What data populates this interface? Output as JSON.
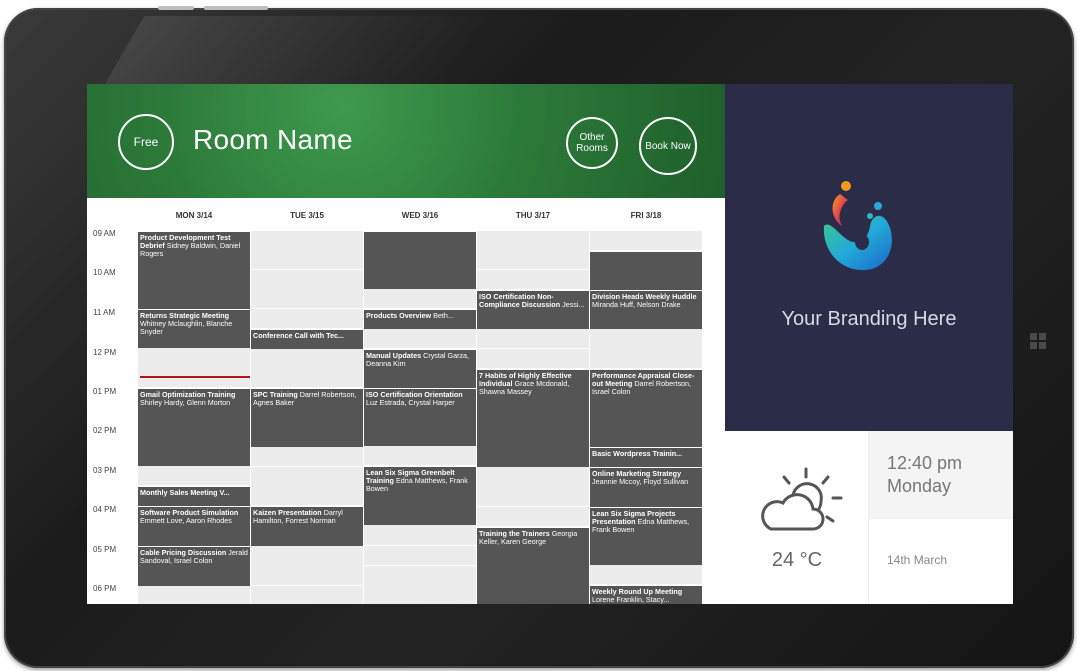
{
  "header": {
    "status": "Free",
    "room_name": "Room Name",
    "other_rooms": "Other Rooms",
    "book_now": "Book Now",
    "accent": "#2c7a3a"
  },
  "calendar": {
    "days": [
      "MON 3/14",
      "TUE 3/15",
      "WED 3/16",
      "THU 3/17",
      "FRI 3/18"
    ],
    "times": [
      "09 AM",
      "10 AM",
      "11 AM",
      "12 PM",
      "01 PM",
      "02 PM",
      "03 PM",
      "04 PM",
      "05 PM",
      "06 PM"
    ],
    "now_indicator_color": "#b3141c",
    "events": {
      "mon": [
        {
          "title": "Product Development Test Debrief",
          "people": " Sidney Baldwin, Daniel Rogers"
        },
        {
          "title": "Returns Strategic Meeting",
          "people": " Whitney Mclaughlin, Blanche Snyder"
        },
        {
          "title": "Gmail Optimization Training",
          "people": " Shirley Hardy, Glenn Morton"
        },
        {
          "title": "Monthly Sales Meeting V...",
          "people": ""
        },
        {
          "title": "Software Product Simulation",
          "people": " Emmett Love, Aaron Rhodes"
        },
        {
          "title": "Cable Pricing Discussion",
          "people": " Jerald Sandoval, Israel Colon"
        }
      ],
      "tue": [
        {
          "title": "Conference Call with Tec...",
          "people": ""
        },
        {
          "title": "SPC Training",
          "people": " Darrel Robertson, Agnes Baker"
        },
        {
          "title": "Kaizen Presentation",
          "people": " Darryl Hamilton, Forrest Norman"
        }
      ],
      "wed": [
        {
          "title": "Products Overview",
          "people": " Beth..."
        },
        {
          "title": "Manual Updates",
          "people": " Crystal Garza, Deanna Kim"
        },
        {
          "title": "ISO Certification Orientation",
          "people": " Luz Estrada, Crystal Harper"
        },
        {
          "title": "Lean Six Sigma Greenbelt Training",
          "people": " Edna Matthews, Frank Bowen"
        }
      ],
      "thu": [
        {
          "title": "ISO Certification Non-Compliance Discussion",
          "people": " Jessi..."
        },
        {
          "title": "7 Habits of Highly Effective Individual",
          "people": " Grace Mcdonald, Shawna Massey"
        },
        {
          "title": "Training the Trainers",
          "people": " Georgia Keller, Karen George"
        }
      ],
      "fri": [
        {
          "title": "Division Heads Weekly Huddle",
          "people": " Miranda Huff, Nelson Drake"
        },
        {
          "title": "Performance Appraisal Close-out Meeting",
          "people": " Darrel Robertson, Israel Colon"
        },
        {
          "title": "Basic Wordpress Trainin...",
          "people": ""
        },
        {
          "title": "Online Marketing Strategy",
          "people": " Jeannie Mccoy, Floyd Sullivan"
        },
        {
          "title": "Lean Six Sigma Projects Presentation",
          "people": " Edna Matthews, Frank Bowen"
        },
        {
          "title": "Weekly Round Up Meeting",
          "people": " Lorene Franklin, Stacy..."
        }
      ]
    }
  },
  "branding": {
    "text": "Your Branding Here",
    "panel_color": "#2b2c47"
  },
  "info": {
    "weather_icon": "partly-sunny-icon",
    "temperature": "24 °C",
    "time": "12:40 pm",
    "weekday": "Monday",
    "date": "14th March"
  }
}
